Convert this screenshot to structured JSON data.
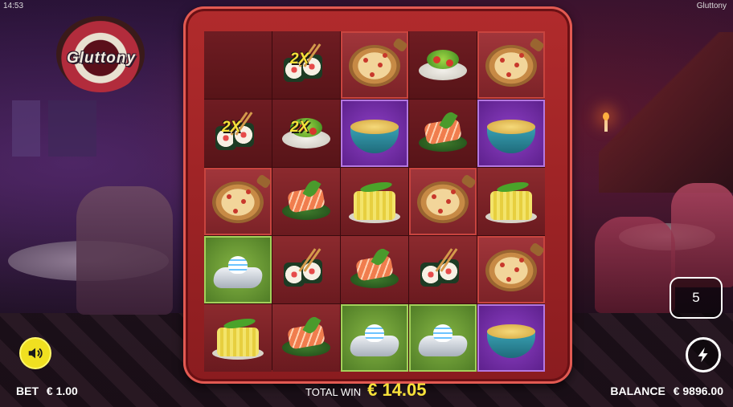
{
  "status": {
    "clock": "14:53",
    "app_title": "Gluttony"
  },
  "logo": {
    "text": "Gluttony"
  },
  "reels": {
    "rows": [
      [
        {
          "symbol": "empty",
          "bg": "darkred",
          "multiplier": ""
        },
        {
          "symbol": "sushi",
          "bg": "darkred",
          "multiplier": "2X"
        },
        {
          "symbol": "pizza",
          "bg": "hl-red",
          "multiplier": ""
        },
        {
          "symbol": "salad",
          "bg": "darkred",
          "multiplier": ""
        },
        {
          "symbol": "pizza",
          "bg": "hl-red",
          "multiplier": ""
        }
      ],
      [
        {
          "symbol": "sushi",
          "bg": "darkred",
          "multiplier": "2X"
        },
        {
          "symbol": "salad",
          "bg": "darkred",
          "multiplier": "2X"
        },
        {
          "symbol": "soup",
          "bg": "purple",
          "multiplier": ""
        },
        {
          "symbol": "salmon",
          "bg": "darkred",
          "multiplier": ""
        },
        {
          "symbol": "soup",
          "bg": "purple",
          "multiplier": ""
        }
      ],
      [
        {
          "symbol": "pizza",
          "bg": "hl-red",
          "multiplier": ""
        },
        {
          "symbol": "salmon",
          "bg": "red",
          "multiplier": ""
        },
        {
          "symbol": "tofu",
          "bg": "red",
          "multiplier": ""
        },
        {
          "symbol": "pizza",
          "bg": "hl-red",
          "multiplier": ""
        },
        {
          "symbol": "tofu",
          "bg": "red",
          "multiplier": ""
        }
      ],
      [
        {
          "symbol": "panna",
          "bg": "green",
          "multiplier": ""
        },
        {
          "symbol": "sushi",
          "bg": "red",
          "multiplier": ""
        },
        {
          "symbol": "salmon",
          "bg": "red",
          "multiplier": ""
        },
        {
          "symbol": "sushi",
          "bg": "red",
          "multiplier": ""
        },
        {
          "symbol": "pizza",
          "bg": "hl-red",
          "multiplier": ""
        }
      ],
      [
        {
          "symbol": "tofu",
          "bg": "red",
          "multiplier": ""
        },
        {
          "symbol": "salmon",
          "bg": "red",
          "multiplier": ""
        },
        {
          "symbol": "panna",
          "bg": "green",
          "multiplier": ""
        },
        {
          "symbol": "panna",
          "bg": "green",
          "multiplier": ""
        },
        {
          "symbol": "soup",
          "bg": "purple",
          "multiplier": ""
        }
      ]
    ]
  },
  "bottom": {
    "bet_label": "BET",
    "bet_value": "€  1.00",
    "total_win_label": "TOTAL WIN",
    "total_win_value": "€  14.05",
    "balance_label": "BALANCE",
    "balance_value": "€  9896.00"
  },
  "controls": {
    "autoplay_count": "5",
    "sound_icon": "speaker-icon",
    "spin_icon": "lightning-icon"
  },
  "colors": {
    "accent_yellow": "#f7e23a",
    "frame_red": "#b12b2c"
  }
}
